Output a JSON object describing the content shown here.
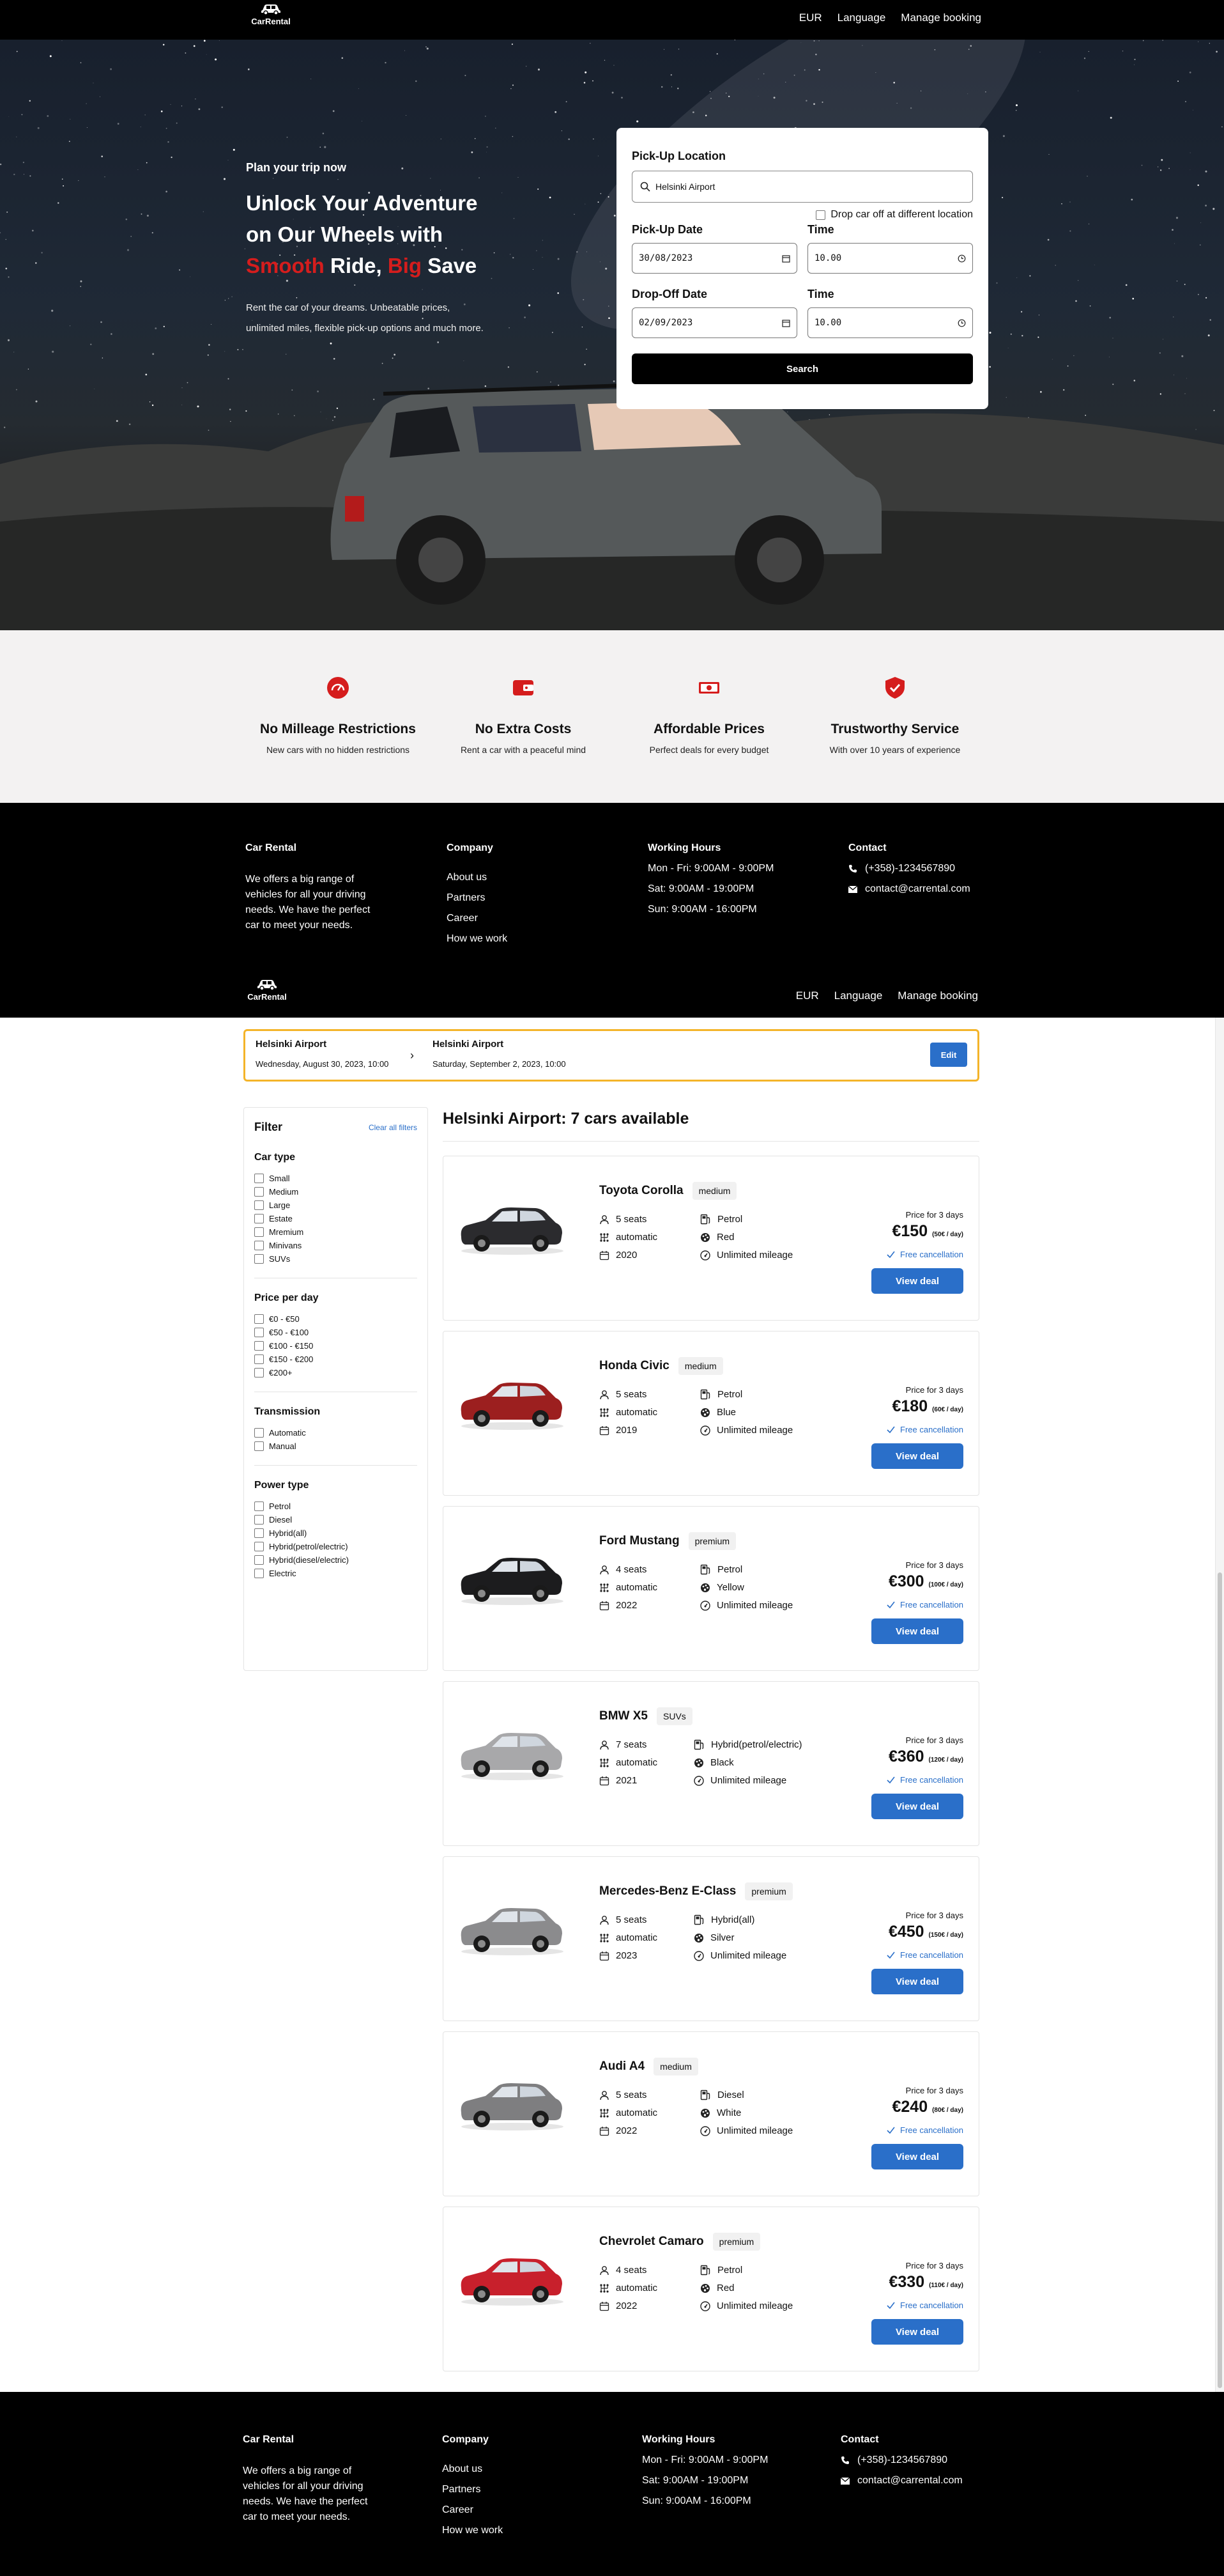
{
  "brand": {
    "name": "CarRental"
  },
  "nav": {
    "currency": "EUR",
    "language": "Language",
    "manage": "Manage booking"
  },
  "hero": {
    "kicker": "Plan your trip now",
    "title_line1": "Unlock Your Adventure",
    "title_line2": "on Our Wheels with",
    "title_w1": "Smooth",
    "title_w2": " Ride, ",
    "title_w3": "Big",
    "title_w4": " Save",
    "description": "Rent the car of your dreams. Unbeatable prices, unlimited miles, flexible pick-up options and much more."
  },
  "search": {
    "pickup_location_label": "Pick-Up Location",
    "pickup_location_value": "Helsinki Airport",
    "dropoff_diff_label": "Drop car off at different location",
    "pickup_date_label": "Pick-Up Date",
    "pickup_date_value": "30/08/2023",
    "pickup_time_label": "Time",
    "pickup_time_value": "10.00",
    "dropoff_date_label": "Drop-Off Date",
    "dropoff_date_value": "02/09/2023",
    "dropoff_time_label": "Time",
    "dropoff_time_value": "10.00",
    "button": "Search"
  },
  "features": [
    {
      "title": "No Milleage Restrictions",
      "desc": "New cars with no hidden restrictions",
      "icon": "speedometer-icon"
    },
    {
      "title": "No Extra Costs",
      "desc": "Rent a car with a peaceful mind",
      "icon": "wallet-icon"
    },
    {
      "title": "Affordable Prices",
      "desc": "Perfect deals for every budget",
      "icon": "money-icon"
    },
    {
      "title": "Trustworthy Service",
      "desc": "With over 10 years of experience",
      "icon": "shield-check-icon"
    }
  ],
  "footer": {
    "about_title": "Car Rental",
    "about_text": "We offers a big range of vehicles for all your driving needs. We have the perfect car to meet your needs.",
    "company_title": "Company",
    "company_links": [
      "About us",
      "Partners",
      "Career",
      "How we work"
    ],
    "hours_title": "Working Hours",
    "hours": [
      "Mon - Fri: 9:00AM - 9:00PM",
      "Sat: 9:00AM - 19:00PM",
      "Sun: 9:00AM - 16:00PM"
    ],
    "contact_title": "Contact",
    "phone": "(+358)-1234567890",
    "email": "contact@carrental.com"
  },
  "trip": {
    "pickup_location": "Helsinki Airport",
    "pickup_datetime": "Wednesday, August 30, 2023, 10:00",
    "dropoff_location": "Helsinki Airport",
    "dropoff_datetime": "Saturday, September 2, 2023, 10:00",
    "edit": "Edit"
  },
  "filters": {
    "title": "Filter",
    "clear": "Clear all filters",
    "groups": [
      {
        "title": "Car type",
        "options": [
          "Small",
          "Medium",
          "Large",
          "Estate",
          "Mremium",
          "Minivans",
          "SUVs"
        ]
      },
      {
        "title": "Price per day",
        "options": [
          "€0 - €50",
          "€50 - €100",
          "€100 - €150",
          "€150 - €200",
          "€200+"
        ]
      },
      {
        "title": "Transmission",
        "options": [
          "Automatic",
          "Manual"
        ]
      },
      {
        "title": "Power type",
        "options": [
          "Petrol",
          "Diesel",
          "Hybrid(all)",
          "Hybrid(petrol/electric)",
          "Hybrid(diesel/electric)",
          "Electric"
        ]
      }
    ]
  },
  "results": {
    "title": "Helsinki Airport: 7 cars available",
    "price_label": "Price for 3 days",
    "free_cancel": "Free cancellation",
    "deal_button": "View deal",
    "cars": [
      {
        "name": "Toyota Corolla",
        "category": "medium",
        "seats": "5 seats",
        "transmission": "automatic",
        "year": "2020",
        "fuel": "Petrol",
        "color": "Red",
        "mileage": "Unlimited mileage",
        "price": "€150",
        "per_day": "(50€ / day)",
        "body_color": "#2b2b2e"
      },
      {
        "name": "Honda Civic",
        "category": "medium",
        "seats": "5 seats",
        "transmission": "automatic",
        "year": "2019",
        "fuel": "Petrol",
        "color": "Blue",
        "mileage": "Unlimited mileage",
        "price": "€180",
        "per_day": "(60€ / day)",
        "body_color": "#9c1f1f"
      },
      {
        "name": "Ford Mustang",
        "category": "premium",
        "seats": "4 seats",
        "transmission": "automatic",
        "year": "2022",
        "fuel": "Petrol",
        "color": "Yellow",
        "mileage": "Unlimited mileage",
        "price": "€300",
        "per_day": "(100€ / day)",
        "body_color": "#1c1c1e"
      },
      {
        "name": "BMW X5",
        "category": "SUVs",
        "seats": "7 seats",
        "transmission": "automatic",
        "year": "2021",
        "fuel": "Hybrid(petrol/electric)",
        "color": "Black",
        "mileage": "Unlimited mileage",
        "price": "€360",
        "per_day": "(120€ / day)",
        "body_color": "#a8a8aa"
      },
      {
        "name": "Mercedes-Benz E-Class",
        "category": "premium",
        "seats": "5 seats",
        "transmission": "automatic",
        "year": "2023",
        "fuel": "Hybrid(all)",
        "color": "Silver",
        "mileage": "Unlimited mileage",
        "price": "€450",
        "per_day": "(150€ / day)",
        "body_color": "#8b8b8d"
      },
      {
        "name": "Audi A4",
        "category": "medium",
        "seats": "5 seats",
        "transmission": "automatic",
        "year": "2022",
        "fuel": "Diesel",
        "color": "White",
        "mileage": "Unlimited mileage",
        "price": "€240",
        "per_day": "(80€ / day)",
        "body_color": "#7e7e80"
      },
      {
        "name": "Chevrolet Camaro",
        "category": "premium",
        "seats": "4 seats",
        "transmission": "automatic",
        "year": "2022",
        "fuel": "Petrol",
        "color": "Red",
        "mileage": "Unlimited mileage",
        "price": "€330",
        "per_day": "(110€ / day)",
        "body_color": "#c8202c"
      }
    ]
  },
  "colors": {
    "accent_red": "#d51d1d",
    "accent_blue": "#2a6fc9",
    "trip_border": "#f4b429"
  }
}
